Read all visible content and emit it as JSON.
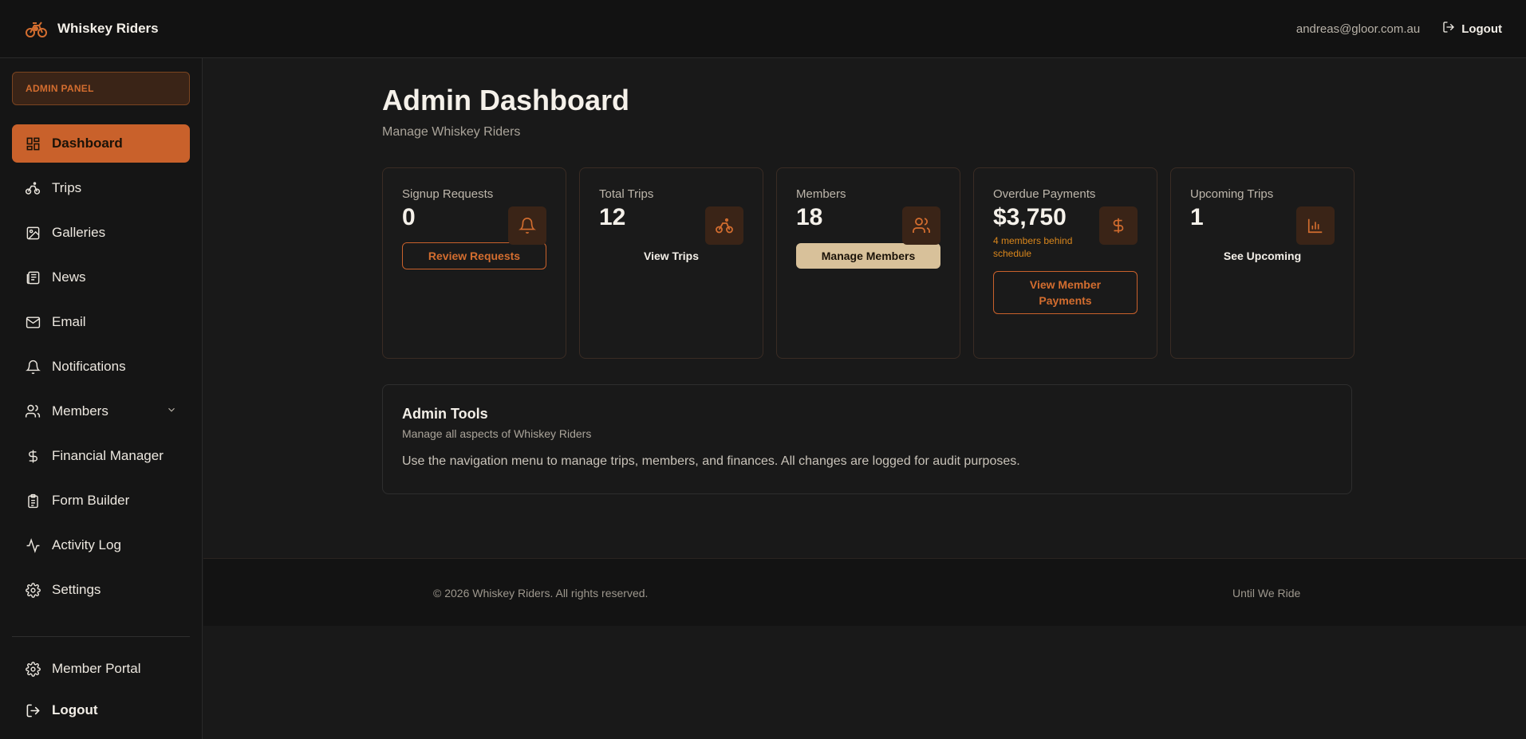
{
  "header": {
    "brand_name": "Whiskey Riders",
    "user_email": "andreas@gloor.com.au",
    "logout_label": "Logout"
  },
  "sidebar": {
    "badge": "ADMIN PANEL",
    "items": [
      {
        "label": "Dashboard",
        "icon": "dashboard-icon",
        "active": true
      },
      {
        "label": "Trips",
        "icon": "bike-icon"
      },
      {
        "label": "Galleries",
        "icon": "image-icon"
      },
      {
        "label": "News",
        "icon": "newspaper-icon"
      },
      {
        "label": "Email",
        "icon": "mail-icon"
      },
      {
        "label": "Notifications",
        "icon": "bell-icon"
      },
      {
        "label": "Members",
        "icon": "users-icon",
        "expandable": true
      },
      {
        "label": "Financial Manager",
        "icon": "dollar-icon"
      },
      {
        "label": "Form Builder",
        "icon": "clipboard-icon"
      },
      {
        "label": "Activity Log",
        "icon": "activity-icon"
      },
      {
        "label": "Settings",
        "icon": "gear-icon"
      }
    ],
    "bottom": {
      "member_portal": "Member Portal",
      "logout": "Logout"
    }
  },
  "main": {
    "title": "Admin Dashboard",
    "subtitle": "Manage Whiskey Riders",
    "cards": [
      {
        "label": "Signup Requests",
        "value": "0",
        "icon": "bell-icon",
        "button": "Review Requests"
      },
      {
        "label": "Total Trips",
        "value": "12",
        "icon": "bike-icon",
        "button": "View Trips"
      },
      {
        "label": "Members",
        "value": "18",
        "icon": "users-icon",
        "button": "Manage Members"
      },
      {
        "label": "Overdue Payments",
        "value": "$3,750",
        "icon": "dollar-icon",
        "note": "4 members behind schedule",
        "button": "View Member Payments"
      },
      {
        "label": "Upcoming Trips",
        "value": "1",
        "icon": "bar-chart-icon",
        "button": "See Upcoming"
      }
    ],
    "tools": {
      "title": "Admin Tools",
      "subtitle": "Manage all aspects of Whiskey Riders",
      "body": "Use the navigation menu to manage trips, members, and finances. All changes are logged for audit purposes."
    }
  },
  "footer": {
    "copyright": "© 2026 Whiskey Riders. All rights reserved.",
    "tagline": "Until We Ride"
  },
  "colors": {
    "accent": "#c9612b",
    "accent_light": "#d8c19a",
    "warning": "#d9861c",
    "background": "#191919"
  }
}
